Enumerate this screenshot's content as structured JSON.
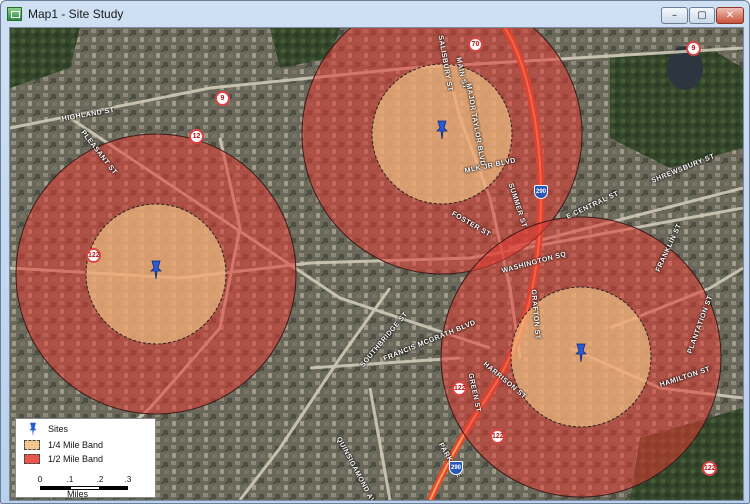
{
  "window": {
    "title": "Map1 - Site Study",
    "controls": {
      "minimize": "–",
      "maximize": "▢",
      "close": "✕"
    }
  },
  "map": {
    "street_labels": [
      "HIGHLAND ST",
      "PLEASANT ST",
      "SALISBURY ST",
      "MAIN ST",
      "MAJOR TAYLOR BLVD",
      "MLK JR BLVD",
      "SUMMER ST",
      "E CENTRAL ST",
      "SHREWSBURY ST",
      "FOSTER ST",
      "WASHINGTON SQ",
      "FRANKLIN ST",
      "GRAFTON ST",
      "PLANTATION ST",
      "SOUTHBRIDGE ST",
      "FRANCIS MCGRATH BLVD",
      "HARRISON ST",
      "GREEN ST",
      "HAMILTON ST",
      "QUINSIGAMOND AVE",
      "PARK AVE"
    ],
    "route_shields": [
      "70",
      "9",
      "9",
      "12",
      "122",
      "122",
      "122",
      "122"
    ],
    "interstate_shields": [
      "290",
      "290"
    ],
    "site_count": 3
  },
  "legend": {
    "sites_label": "Sites",
    "band_quarter_label": "1/4 Mile Band",
    "band_half_label": "1/2 Mile Band",
    "quarter_band_color": "#f0c78a",
    "half_band_color": "#e8564d",
    "scale": {
      "ticks": [
        "0",
        ".1",
        ".2",
        ".3"
      ],
      "units": "Miles"
    }
  }
}
